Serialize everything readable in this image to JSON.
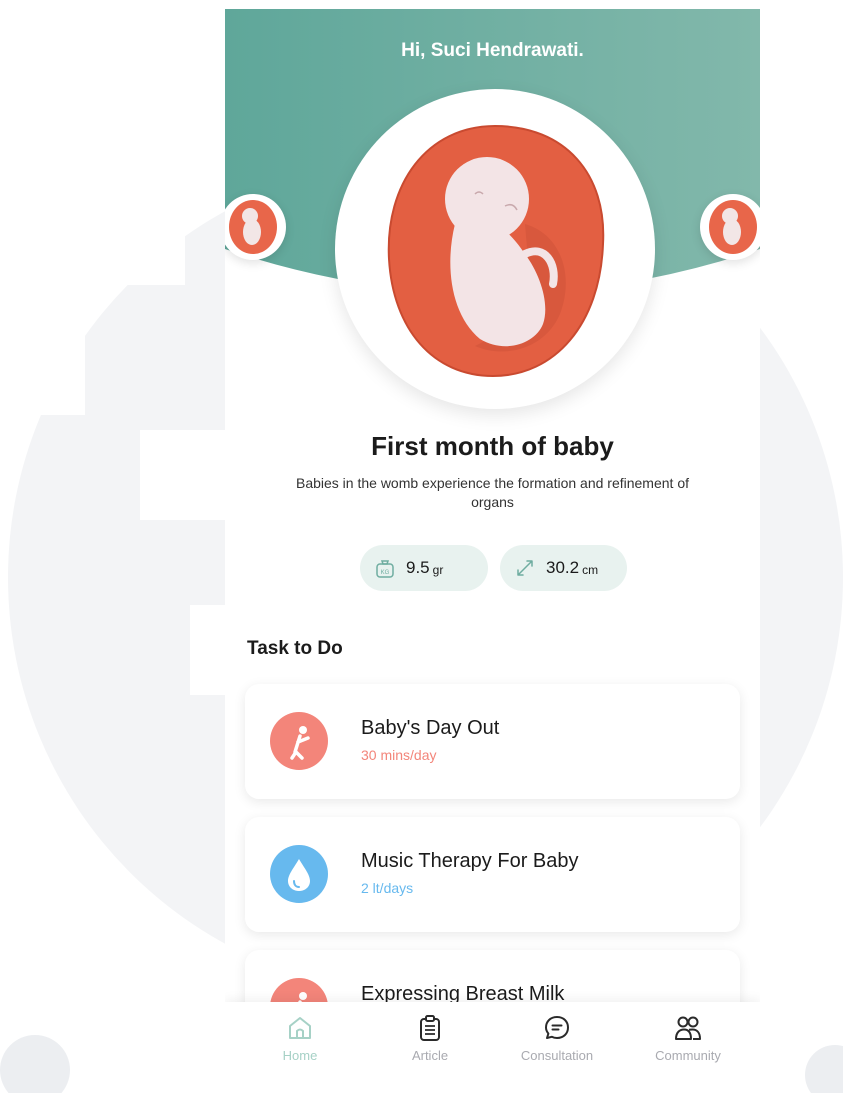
{
  "header": {
    "greeting": "Hi, Suci Hendrawati."
  },
  "hero": {
    "title": "First month of baby",
    "description": "Babies in the womb experience the formation and refinement of organs",
    "weight": {
      "value": "9.5",
      "unit": "gr"
    },
    "length": {
      "value": "30.2",
      "unit": "cm"
    }
  },
  "tasks": {
    "section_title": "Task to Do",
    "items": [
      {
        "name": "Baby's Day Out",
        "detail": "30 mins/day",
        "icon": "stretching-person-icon"
      },
      {
        "name": "Music Therapy For Baby",
        "detail": "2 lt/days",
        "icon": "water-drop-icon"
      },
      {
        "name": "Expressing Breast Milk",
        "detail": "",
        "icon": "stretching-person-icon"
      }
    ]
  },
  "nav": {
    "items": [
      {
        "label": "Home",
        "icon": "home-icon"
      },
      {
        "label": "Article",
        "icon": "clipboard-icon"
      },
      {
        "label": "Consultation",
        "icon": "chat-icon"
      },
      {
        "label": "Community",
        "icon": "people-icon"
      }
    ]
  },
  "colors": {
    "header": "#6fada0",
    "accent": "#e8664a",
    "accent_light": "#f3857a",
    "blue": "#67b9ee",
    "pill": "#e8f2ef"
  }
}
